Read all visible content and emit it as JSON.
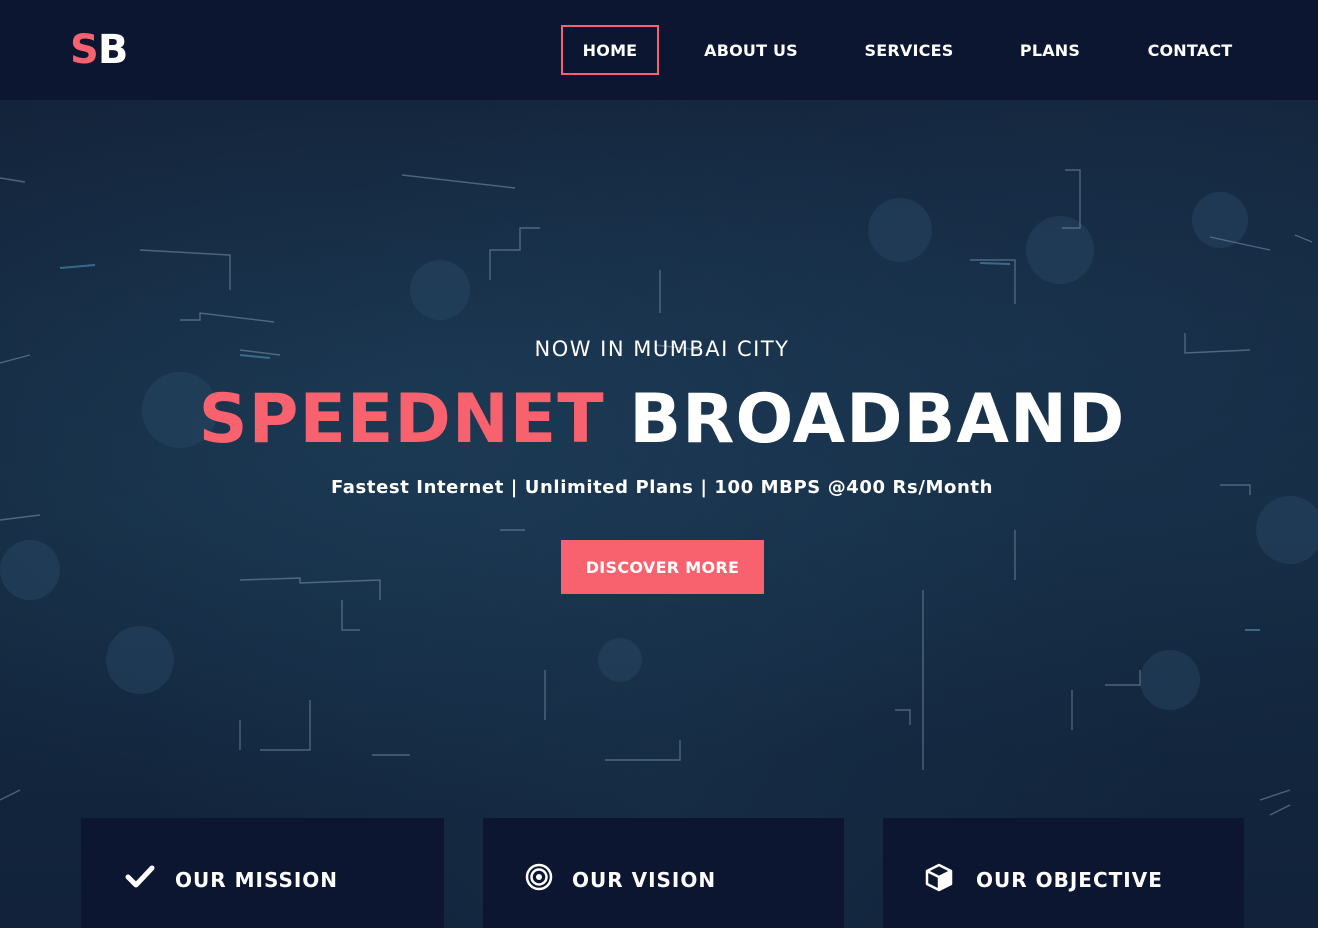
{
  "logo": {
    "first": "S",
    "second": "B"
  },
  "nav": {
    "items": [
      {
        "label": "HOME",
        "active": true
      },
      {
        "label": "ABOUT US",
        "active": false
      },
      {
        "label": "SERVICES",
        "active": false
      },
      {
        "label": "PLANS",
        "active": false
      },
      {
        "label": "CONTACT",
        "active": false
      }
    ]
  },
  "hero": {
    "eyebrow": "NOW IN MUMBAI CITY",
    "headline_accent": "SPEEDNET",
    "headline_rest": "BROADBAND",
    "tagline": "Fastest Internet | Unlimited Plans | 100 MBPS @400 Rs/Month",
    "cta_label": "DISCOVER MORE"
  },
  "cards": [
    {
      "title": "OUR MISSION",
      "icon": "checkmark-icon"
    },
    {
      "title": "OUR VISION",
      "icon": "target-icon"
    },
    {
      "title": "OUR OBJECTIVE",
      "icon": "cube-icon"
    }
  ],
  "colors": {
    "accent": "#f7626e",
    "header_bg": "#0d1630",
    "hero_bg": "#13233a",
    "text": "#ffffff"
  }
}
